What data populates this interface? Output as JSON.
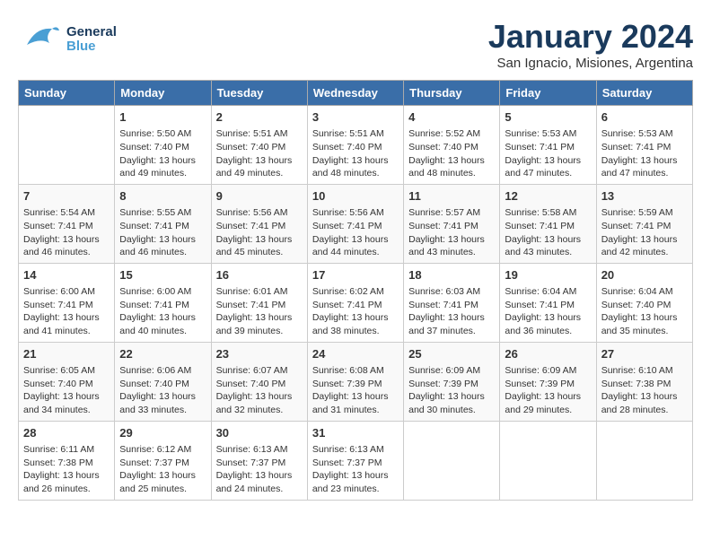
{
  "header": {
    "logo": {
      "general": "General",
      "blue": "Blue",
      "bird": "🐦"
    },
    "month_title": "January 2024",
    "subtitle": "San Ignacio, Misiones, Argentina"
  },
  "days_of_week": [
    "Sunday",
    "Monday",
    "Tuesday",
    "Wednesday",
    "Thursday",
    "Friday",
    "Saturday"
  ],
  "weeks": [
    [
      {
        "day": "",
        "content": ""
      },
      {
        "day": "1",
        "content": "Sunrise: 5:50 AM\nSunset: 7:40 PM\nDaylight: 13 hours\nand 49 minutes."
      },
      {
        "day": "2",
        "content": "Sunrise: 5:51 AM\nSunset: 7:40 PM\nDaylight: 13 hours\nand 49 minutes."
      },
      {
        "day": "3",
        "content": "Sunrise: 5:51 AM\nSunset: 7:40 PM\nDaylight: 13 hours\nand 48 minutes."
      },
      {
        "day": "4",
        "content": "Sunrise: 5:52 AM\nSunset: 7:40 PM\nDaylight: 13 hours\nand 48 minutes."
      },
      {
        "day": "5",
        "content": "Sunrise: 5:53 AM\nSunset: 7:41 PM\nDaylight: 13 hours\nand 47 minutes."
      },
      {
        "day": "6",
        "content": "Sunrise: 5:53 AM\nSunset: 7:41 PM\nDaylight: 13 hours\nand 47 minutes."
      }
    ],
    [
      {
        "day": "7",
        "content": "Sunrise: 5:54 AM\nSunset: 7:41 PM\nDaylight: 13 hours\nand 46 minutes."
      },
      {
        "day": "8",
        "content": "Sunrise: 5:55 AM\nSunset: 7:41 PM\nDaylight: 13 hours\nand 46 minutes."
      },
      {
        "day": "9",
        "content": "Sunrise: 5:56 AM\nSunset: 7:41 PM\nDaylight: 13 hours\nand 45 minutes."
      },
      {
        "day": "10",
        "content": "Sunrise: 5:56 AM\nSunset: 7:41 PM\nDaylight: 13 hours\nand 44 minutes."
      },
      {
        "day": "11",
        "content": "Sunrise: 5:57 AM\nSunset: 7:41 PM\nDaylight: 13 hours\nand 43 minutes."
      },
      {
        "day": "12",
        "content": "Sunrise: 5:58 AM\nSunset: 7:41 PM\nDaylight: 13 hours\nand 43 minutes."
      },
      {
        "day": "13",
        "content": "Sunrise: 5:59 AM\nSunset: 7:41 PM\nDaylight: 13 hours\nand 42 minutes."
      }
    ],
    [
      {
        "day": "14",
        "content": "Sunrise: 6:00 AM\nSunset: 7:41 PM\nDaylight: 13 hours\nand 41 minutes."
      },
      {
        "day": "15",
        "content": "Sunrise: 6:00 AM\nSunset: 7:41 PM\nDaylight: 13 hours\nand 40 minutes."
      },
      {
        "day": "16",
        "content": "Sunrise: 6:01 AM\nSunset: 7:41 PM\nDaylight: 13 hours\nand 39 minutes."
      },
      {
        "day": "17",
        "content": "Sunrise: 6:02 AM\nSunset: 7:41 PM\nDaylight: 13 hours\nand 38 minutes."
      },
      {
        "day": "18",
        "content": "Sunrise: 6:03 AM\nSunset: 7:41 PM\nDaylight: 13 hours\nand 37 minutes."
      },
      {
        "day": "19",
        "content": "Sunrise: 6:04 AM\nSunset: 7:41 PM\nDaylight: 13 hours\nand 36 minutes."
      },
      {
        "day": "20",
        "content": "Sunrise: 6:04 AM\nSunset: 7:40 PM\nDaylight: 13 hours\nand 35 minutes."
      }
    ],
    [
      {
        "day": "21",
        "content": "Sunrise: 6:05 AM\nSunset: 7:40 PM\nDaylight: 13 hours\nand 34 minutes."
      },
      {
        "day": "22",
        "content": "Sunrise: 6:06 AM\nSunset: 7:40 PM\nDaylight: 13 hours\nand 33 minutes."
      },
      {
        "day": "23",
        "content": "Sunrise: 6:07 AM\nSunset: 7:40 PM\nDaylight: 13 hours\nand 32 minutes."
      },
      {
        "day": "24",
        "content": "Sunrise: 6:08 AM\nSunset: 7:39 PM\nDaylight: 13 hours\nand 31 minutes."
      },
      {
        "day": "25",
        "content": "Sunrise: 6:09 AM\nSunset: 7:39 PM\nDaylight: 13 hours\nand 30 minutes."
      },
      {
        "day": "26",
        "content": "Sunrise: 6:09 AM\nSunset: 7:39 PM\nDaylight: 13 hours\nand 29 minutes."
      },
      {
        "day": "27",
        "content": "Sunrise: 6:10 AM\nSunset: 7:38 PM\nDaylight: 13 hours\nand 28 minutes."
      }
    ],
    [
      {
        "day": "28",
        "content": "Sunrise: 6:11 AM\nSunset: 7:38 PM\nDaylight: 13 hours\nand 26 minutes."
      },
      {
        "day": "29",
        "content": "Sunrise: 6:12 AM\nSunset: 7:37 PM\nDaylight: 13 hours\nand 25 minutes."
      },
      {
        "day": "30",
        "content": "Sunrise: 6:13 AM\nSunset: 7:37 PM\nDaylight: 13 hours\nand 24 minutes."
      },
      {
        "day": "31",
        "content": "Sunrise: 6:13 AM\nSunset: 7:37 PM\nDaylight: 13 hours\nand 23 minutes."
      },
      {
        "day": "",
        "content": ""
      },
      {
        "day": "",
        "content": ""
      },
      {
        "day": "",
        "content": ""
      }
    ]
  ]
}
